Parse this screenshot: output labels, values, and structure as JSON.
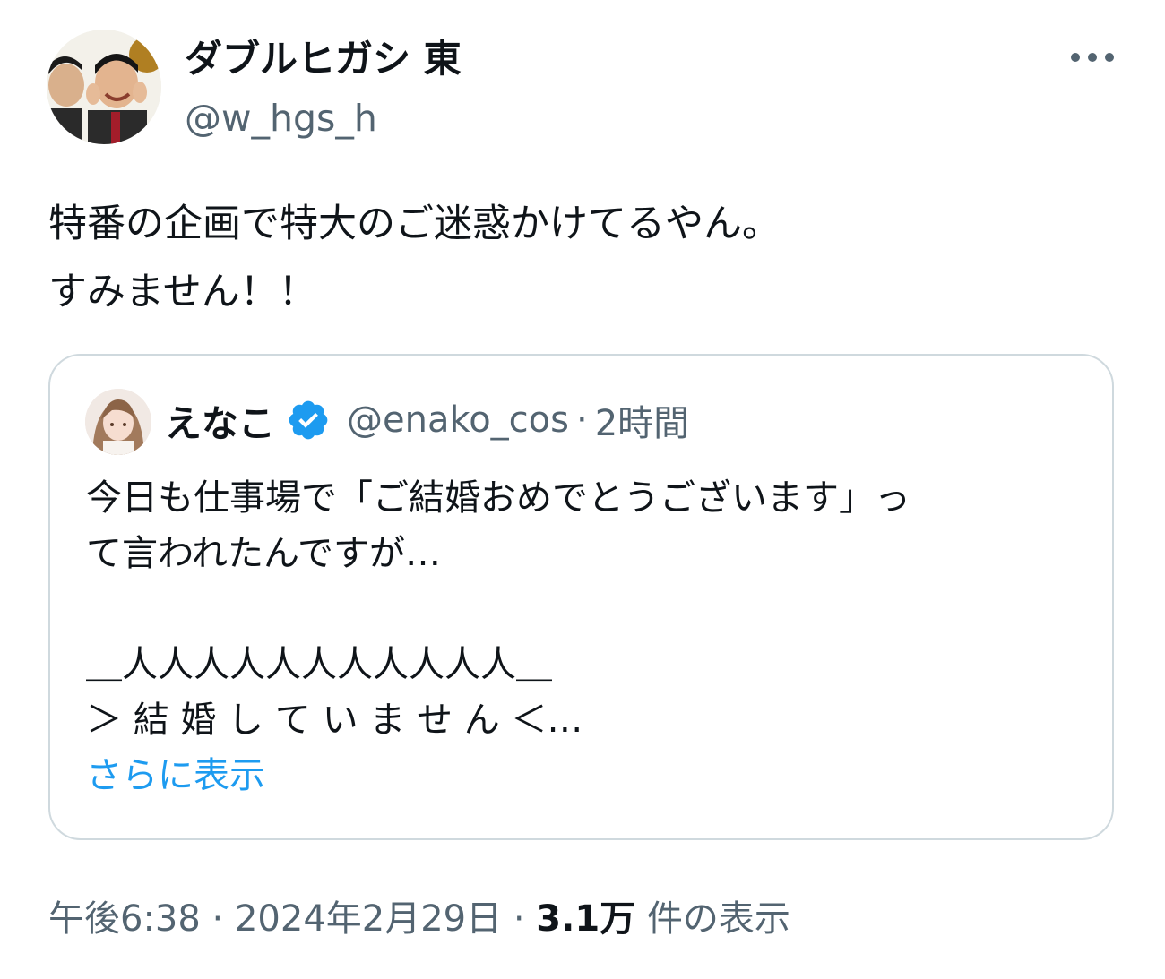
{
  "author": {
    "display_name": "ダブルヒガシ 東",
    "handle": "@w_hgs_h",
    "avatar_icon": "avatar-photo"
  },
  "more_icon": "more-options-icon",
  "tweet": {
    "lines": [
      "特番の企画で特大のご迷惑かけてるやん。",
      "すみません！！"
    ]
  },
  "quote": {
    "name": "えなこ",
    "verified_icon": "verified-badge-icon",
    "handle": "@enako_cos",
    "separator": "·",
    "time": "2時間",
    "lines": [
      "今日も仕事場で「ご結婚おめでとうございます」っ",
      "て言われたんですが…",
      "",
      "＿人人人人人人人人人人人＿",
      "＞ 結 婚 し て い ま せ ん ＜…"
    ],
    "show_more": "さらに表示"
  },
  "meta": {
    "time": "午後6:38",
    "separator": "·",
    "date": "2024年2月29日",
    "views_count": "3.1万",
    "views_label": "件の表示"
  },
  "colors": {
    "text_primary": "#0f1419",
    "text_secondary": "#536471",
    "link": "#1d9bf0",
    "verified": "#1d9bf0",
    "border": "#cfd9de"
  }
}
